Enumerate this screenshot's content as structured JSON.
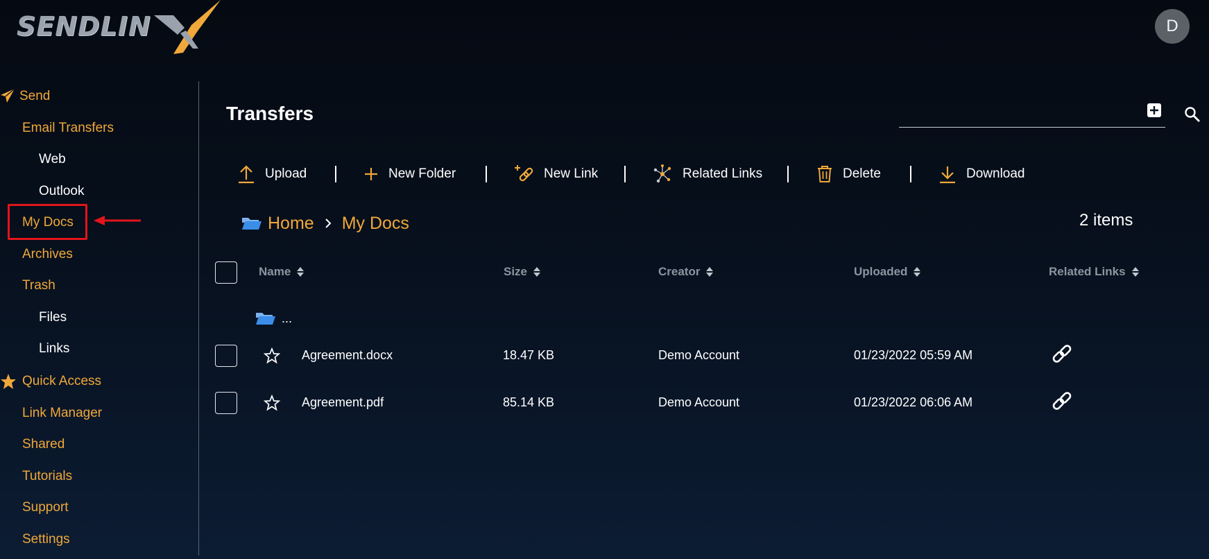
{
  "app": {
    "logo_text": "SENDLIN",
    "avatar_letter": "D"
  },
  "sidebar": {
    "send": "Send",
    "email_transfers": "Email Transfers",
    "web": "Web",
    "outlook": "Outlook",
    "my_docs": "My Docs",
    "archives": "Archives",
    "trash": "Trash",
    "files": "Files",
    "links": "Links",
    "quick_access": "Quick Access",
    "link_manager": "Link Manager",
    "shared": "Shared",
    "tutorials": "Tutorials",
    "support": "Support",
    "settings": "Settings"
  },
  "main": {
    "title": "Transfers",
    "search_placeholder": "",
    "item_count": "2 items"
  },
  "toolbar": {
    "upload": "Upload",
    "new_folder": "New Folder",
    "new_link": "New Link",
    "related_links": "Related Links",
    "delete": "Delete",
    "download": "Download"
  },
  "breadcrumb": {
    "home": "Home",
    "current": "My Docs"
  },
  "table": {
    "headers": {
      "name": "Name",
      "size": "Size",
      "creator": "Creator",
      "uploaded": "Uploaded",
      "related_links": "Related Links"
    },
    "parent_folder": "...",
    "rows": [
      {
        "name": "Agreement.docx",
        "size": "18.47 KB",
        "creator": "Demo Account",
        "uploaded": "01/23/2022 05:59 AM"
      },
      {
        "name": "Agreement.pdf",
        "size": "85.14 KB",
        "creator": "Demo Account",
        "uploaded": "01/23/2022 06:06 AM"
      }
    ]
  },
  "colors": {
    "accent": "#f0a83a",
    "highlight": "#e3141b",
    "folder": "#3b8ee8"
  }
}
